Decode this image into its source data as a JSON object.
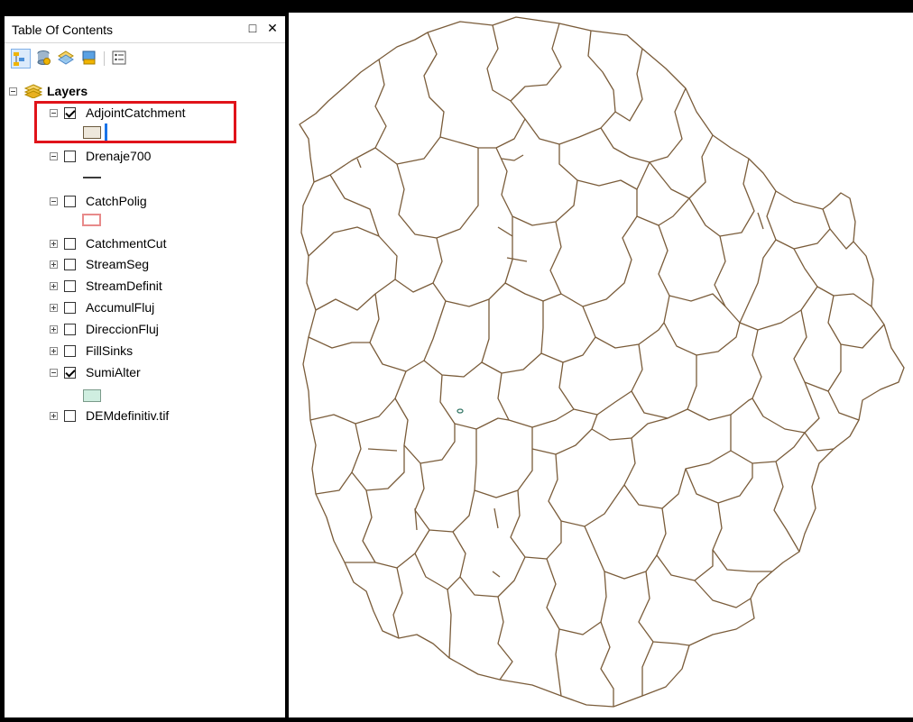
{
  "toc": {
    "title": "Table Of Contents",
    "restore_icon": "□",
    "close_icon": "✕",
    "toolbar": [
      {
        "name": "list-by-drawing-order-icon"
      },
      {
        "name": "list-by-source-icon"
      },
      {
        "name": "list-by-visibility-icon"
      },
      {
        "name": "list-by-selection-icon"
      },
      {
        "name": "options-icon"
      }
    ],
    "root": {
      "label": "Layers"
    },
    "layers": [
      {
        "label": "AdjointCatchment",
        "checked": true,
        "expanded": true,
        "symbol": "polygon-tan"
      },
      {
        "label": "Drenaje700",
        "checked": false,
        "expanded": true,
        "symbol": "line-dark"
      },
      {
        "label": "CatchPolig",
        "checked": false,
        "expanded": true,
        "symbol": "polygon-pink"
      },
      {
        "label": "CatchmentCut",
        "checked": false,
        "expanded": false
      },
      {
        "label": "StreamSeg",
        "checked": false,
        "expanded": false
      },
      {
        "label": "StreamDefinit",
        "checked": false,
        "expanded": false
      },
      {
        "label": "AccumulFluj",
        "checked": false,
        "expanded": false
      },
      {
        "label": "DireccionFluj",
        "checked": false,
        "expanded": false
      },
      {
        "label": "FillSinks",
        "checked": false,
        "expanded": false
      },
      {
        "label": "SumiAlter",
        "checked": true,
        "expanded": true,
        "symbol": "polygon-mint"
      },
      {
        "label": "DEMdefinitiv.tif",
        "checked": false,
        "expanded": false
      }
    ]
  },
  "colors": {
    "catchment_line": "#7a5c3a",
    "highlight": "#e0131a",
    "symbol_tan_fill": "#eee8dc",
    "symbol_pink_stroke": "#e88a8a",
    "symbol_mint_fill": "#cfeee0",
    "caret": "#1a73e8"
  }
}
